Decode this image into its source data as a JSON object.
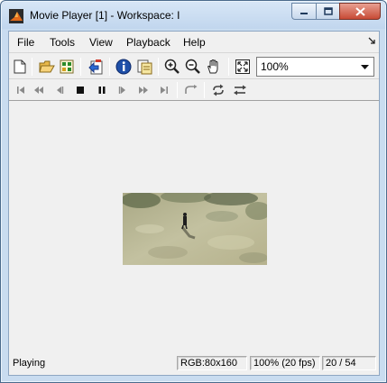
{
  "window": {
    "title": "Movie Player [1] - Workspace: I",
    "app_icon": "matlab-icon",
    "caption_buttons": [
      "minimize-icon",
      "maximize-icon",
      "close-icon"
    ]
  },
  "menu": {
    "items": [
      "File",
      "Tools",
      "View",
      "Playback",
      "Help"
    ],
    "overflow_icon": "dock-arrow-icon"
  },
  "toolbar": {
    "icons": [
      "new-icon",
      "open-icon",
      "import-icon",
      "export-icon",
      "info-icon",
      "properties-icon",
      "zoom-in-icon",
      "zoom-out-icon",
      "pan-hand-icon",
      "fit-to-window-icon"
    ],
    "zoom_value": "100%"
  },
  "playback_controls": {
    "icons": [
      "go-to-first-icon",
      "rewind-icon",
      "step-back-icon",
      "stop-icon",
      "pause-icon",
      "step-forward-icon",
      "fast-forward-icon",
      "go-to-last-icon",
      "jump-to-icon",
      "loop-icon",
      "play-direction-icon"
    ]
  },
  "status": {
    "state": "Playing",
    "image_info": "RGB:80x160",
    "zoom_fps": "100% (20 fps)",
    "frame_counter": "20 / 54"
  },
  "colors": {
    "titlebar": "#c9dcf0",
    "client_background": "#f0f0f0",
    "close_button": "#c74a35",
    "frame_ground": "#b8b48e"
  }
}
